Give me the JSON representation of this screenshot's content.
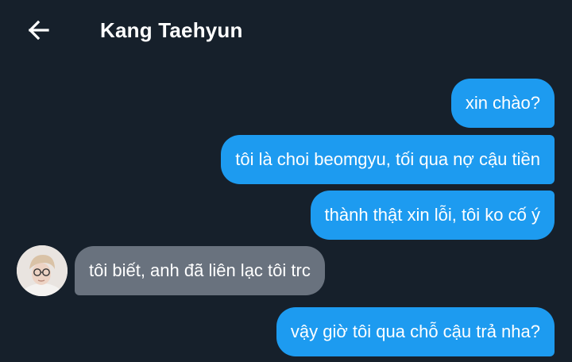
{
  "header": {
    "back_icon": "arrow-left-icon",
    "title": "Kang Taehyun"
  },
  "colors": {
    "background": "#16202b",
    "outgoing_bubble": "#1d9bf0",
    "incoming_bubble": "#69727e",
    "text": "#ffffff"
  },
  "messages": [
    {
      "direction": "outgoing",
      "text": "xin chào?"
    },
    {
      "direction": "outgoing",
      "text": "tôi là choi beomgyu, tối qua nợ cậu tiền"
    },
    {
      "direction": "outgoing",
      "text": "thành thật xin lỗi, tôi ko cố ý"
    },
    {
      "direction": "incoming",
      "text": "tôi biết, anh đã liên lạc tôi trc"
    },
    {
      "direction": "outgoing",
      "text": "vậy giờ tôi qua chỗ cậu trả nha?"
    }
  ]
}
